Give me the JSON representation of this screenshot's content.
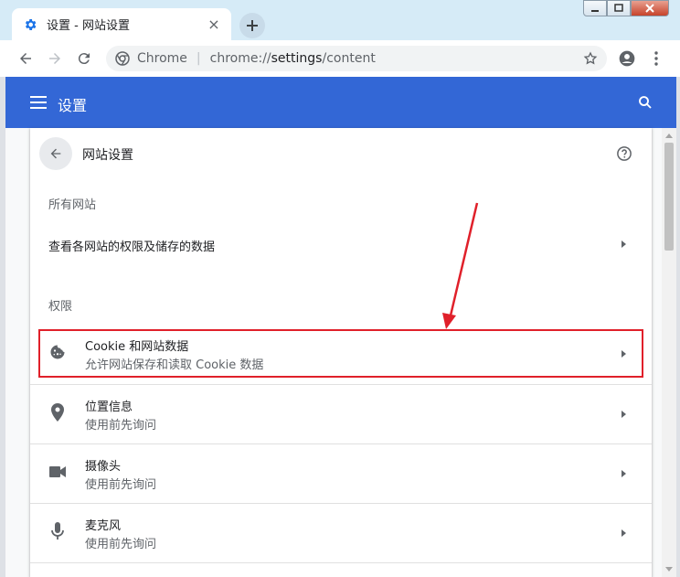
{
  "tab": {
    "title": "设置 - 网站设置",
    "favicon": "gear-icon",
    "close": "×"
  },
  "toolbar": {
    "site_name": "Chrome",
    "separator": "|",
    "url_scheme": "chrome://",
    "url_host": "settings",
    "url_path": "/content"
  },
  "header": {
    "title": "设置"
  },
  "page": {
    "title": "网站设置",
    "all_sites_heading": "所有网站",
    "all_sites_link": "查看各网站的权限及储存的数据",
    "permissions_heading": "权限"
  },
  "permissions": [
    {
      "title": "Cookie 和网站数据",
      "subtitle": "允许网站保存和读取 Cookie 数据",
      "icon": "cookie-icon"
    },
    {
      "title": "位置信息",
      "subtitle": "使用前先询问",
      "icon": "location-pin-icon"
    },
    {
      "title": "摄像头",
      "subtitle": "使用前先询问",
      "icon": "camera-icon"
    },
    {
      "title": "麦克风",
      "subtitle": "使用前先询问",
      "icon": "microphone-icon"
    }
  ],
  "colors": {
    "header_blue": "#3367d6",
    "annotation_red": "#e0202a",
    "tab_strip": "#d6ebf7"
  }
}
